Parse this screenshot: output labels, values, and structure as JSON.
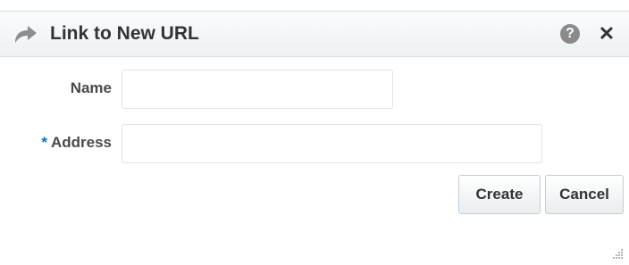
{
  "dialog": {
    "title": "Link to New URL",
    "help_glyph": "?",
    "close_glyph": "✕"
  },
  "form": {
    "name_label": "Name",
    "name_value": "",
    "address_required_marker": "*",
    "address_label": "Address",
    "address_value": ""
  },
  "buttons": {
    "create_label": "Create",
    "cancel_label": "Cancel"
  },
  "icons": {
    "title": "share-arrow-icon",
    "help": "help-icon",
    "close": "close-icon",
    "resize": "resize-grip-icon"
  },
  "colors": {
    "required_marker": "#0572ce",
    "help_icon_bg": "#8a8a8a"
  }
}
